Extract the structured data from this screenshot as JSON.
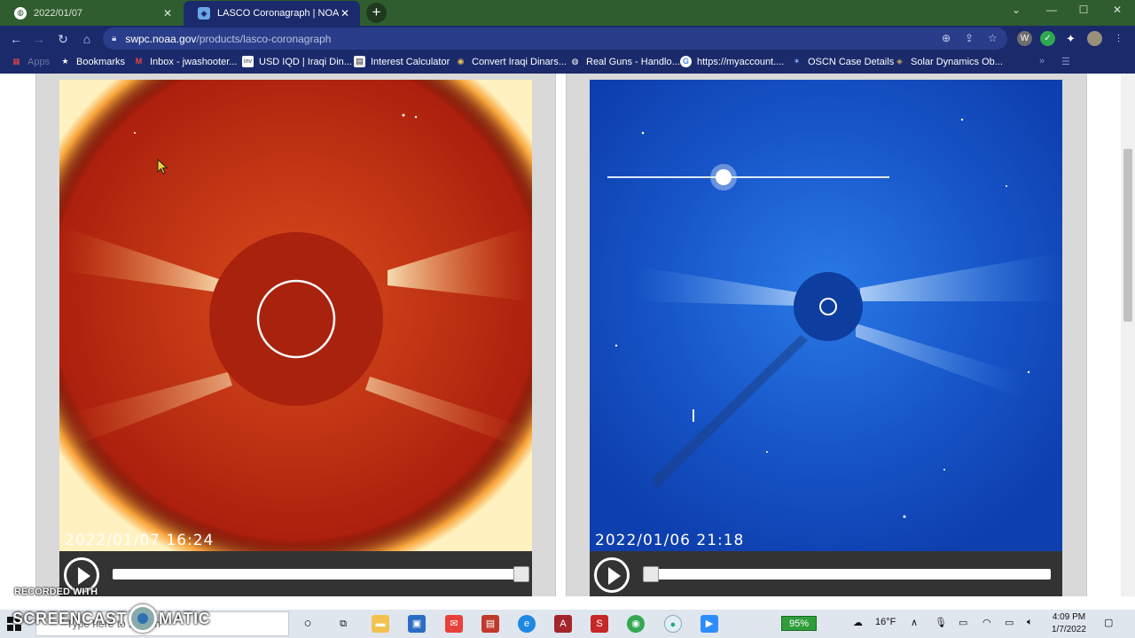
{
  "browser": {
    "tabs": [
      {
        "title": "2022/01/07",
        "active": false
      },
      {
        "title": "LASCO Coronagraph | NOAA / N",
        "active": true
      }
    ],
    "url_domain": "swpc.noaa.gov",
    "url_path": "/products/lasco-coronagraph",
    "bookmarks": [
      {
        "label": "Apps",
        "icon": "apps-grid-icon"
      },
      {
        "label": "Bookmarks",
        "icon": "star-icon"
      },
      {
        "label": "Inbox - jwashooter...",
        "icon": "gmail-icon"
      },
      {
        "label": "USD IQD | Iraqi Din...",
        "icon": "inv-icon"
      },
      {
        "label": "Interest Calculator",
        "icon": "calculator-icon"
      },
      {
        "label": "Convert Iraqi Dinars...",
        "icon": "currency-icon"
      },
      {
        "label": "Real Guns - Handlo...",
        "icon": "globe-icon"
      },
      {
        "label": "https://myaccount....",
        "icon": "google-icon"
      },
      {
        "label": "OSCN Case Details",
        "icon": "oscn-icon"
      },
      {
        "label": "Solar Dynamics Ob...",
        "icon": "sdo-icon"
      }
    ]
  },
  "viewers": {
    "left": {
      "timestamp": "2022/01/07  16:24",
      "playback_position": 1.0,
      "tint": "#b32010"
    },
    "right": {
      "timestamp": "2022/01/06  21:18",
      "playback_position": 0.0,
      "tint": "#1a5fd6"
    }
  },
  "watermark": {
    "line1": "RECORDED WITH",
    "line2_left": "SCREENCAST",
    "line2_right": "MATIC"
  },
  "taskbar": {
    "search_placeholder": "Type here to search",
    "battery_percent": "95%",
    "temperature": "16°F",
    "time": "4:09 PM",
    "date": "1/7/2022"
  }
}
